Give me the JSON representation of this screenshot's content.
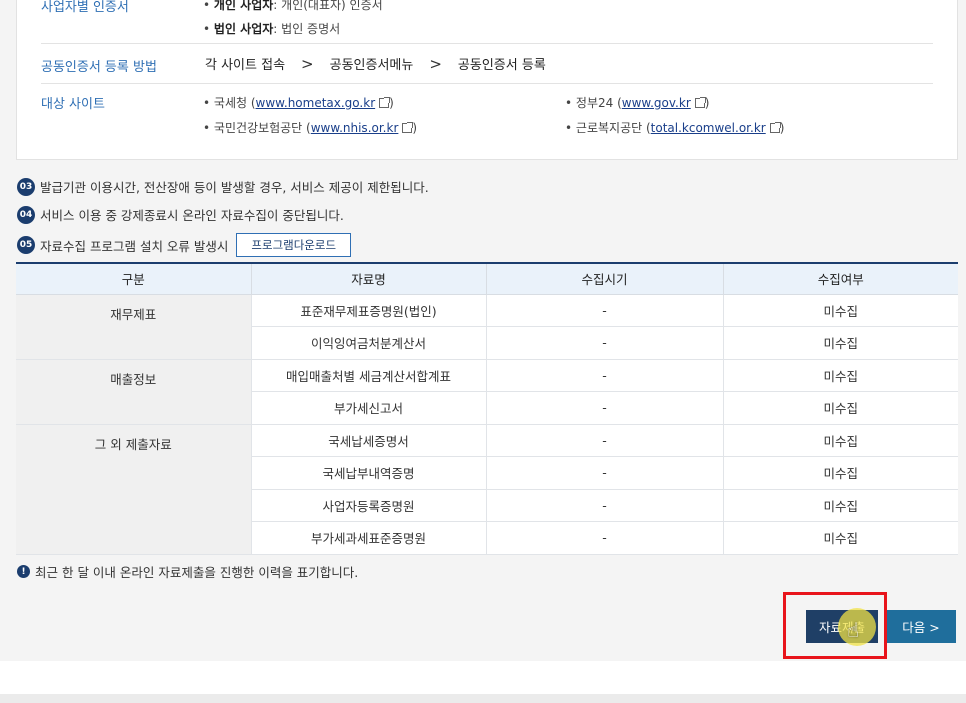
{
  "cert_section": {
    "label": "사업자별 인증서",
    "individual_title": "개인 사업자",
    "individual_desc": ": 개인(대표자) 인증서",
    "corporate_title": "법인 사업자",
    "corporate_desc": ": 법인 증명서"
  },
  "method_section": {
    "label": "공동인증서 등록 방법",
    "steps": [
      "각 사이트 접속",
      "공동인증서메뉴",
      "공동인증서 등록"
    ],
    "separator": ">"
  },
  "sites_section": {
    "label": "대상 사이트",
    "sites": [
      {
        "name": "국세청",
        "url": "www.hometax.go.kr"
      },
      {
        "name": "정부24",
        "url": "www.gov.kr"
      },
      {
        "name": "국민건강보험공단",
        "url": "www.nhis.or.kr"
      },
      {
        "name": "근로복지공단",
        "url": "total.kcomwel.or.kr"
      }
    ]
  },
  "notices": [
    {
      "num": "03",
      "text": "발급기관 이용시간, 전산장애 등이 발생할 경우, 서비스 제공이 제한됩니다."
    },
    {
      "num": "04",
      "text": "서비스 이용 중 강제종료시 온라인 자료수집이 중단됩니다."
    },
    {
      "num": "05",
      "text": "자료수집 프로그램 설치 오류 발생시"
    }
  ],
  "download_button": "프로그램다운로드",
  "table": {
    "headers": [
      "구분",
      "자료명",
      "수집시기",
      "수집여부"
    ],
    "groups": [
      {
        "category": "재무제표",
        "rows": [
          {
            "name": "표준재무제표증명원(법인)",
            "time": "-",
            "status": "미수집"
          },
          {
            "name": "이익잉여금처분계산서",
            "time": "-",
            "status": "미수집"
          }
        ]
      },
      {
        "category": "매출정보",
        "rows": [
          {
            "name": "매입매출처별 세금계산서합계표",
            "time": "-",
            "status": "미수집"
          },
          {
            "name": "부가세신고서",
            "time": "-",
            "status": "미수집"
          }
        ]
      },
      {
        "category": "그 외 제출자료",
        "rows": [
          {
            "name": "국세납세증명서",
            "time": "-",
            "status": "미수집"
          },
          {
            "name": "국세납부내역증명",
            "time": "-",
            "status": "미수집"
          },
          {
            "name": "사업자등록증명원",
            "time": "-",
            "status": "미수집"
          },
          {
            "name": "부가세과세표준증명원",
            "time": "-",
            "status": "미수집"
          }
        ]
      }
    ]
  },
  "footnote": "최근 한 달 이내 온라인 자료제출을 진행한 이력을 표기합니다.",
  "footnote_icon": "!",
  "buttons": {
    "submit": "자료제출",
    "next": "다음 >"
  },
  "colors": {
    "accent": "#1b3d6e",
    "link": "#2f6fb4",
    "highlight": "#e8141b",
    "next": "#1f6e9c"
  }
}
